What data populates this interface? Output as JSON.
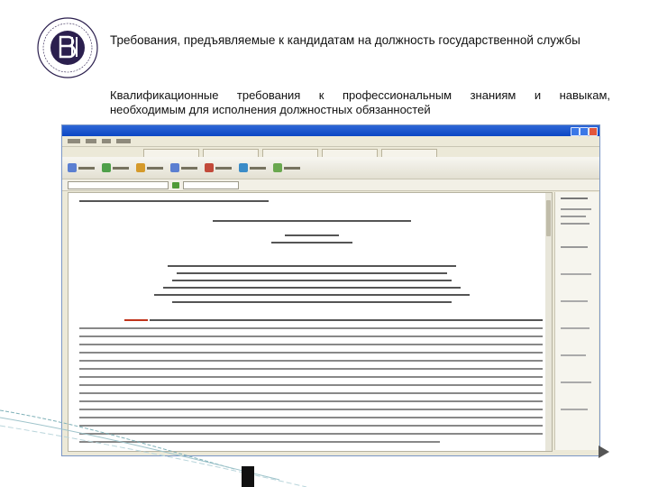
{
  "slide": {
    "title": "Требования, предъявляемые к кандидатам на должность государственной службы",
    "subtitle_line1": "Квалификационные требования к профессиональным знаниям и навыкам,",
    "subtitle_line2": "необходимым для исполнения должностных обязанностей"
  },
  "colors": {
    "logo": "#2b1f4e",
    "window_titlebar": "#0a46c4",
    "link": "#c0341b",
    "deco_line": "#7fb1b8"
  },
  "icons": {
    "logo": "university-seal-icon",
    "play": "play-triangle-icon"
  }
}
